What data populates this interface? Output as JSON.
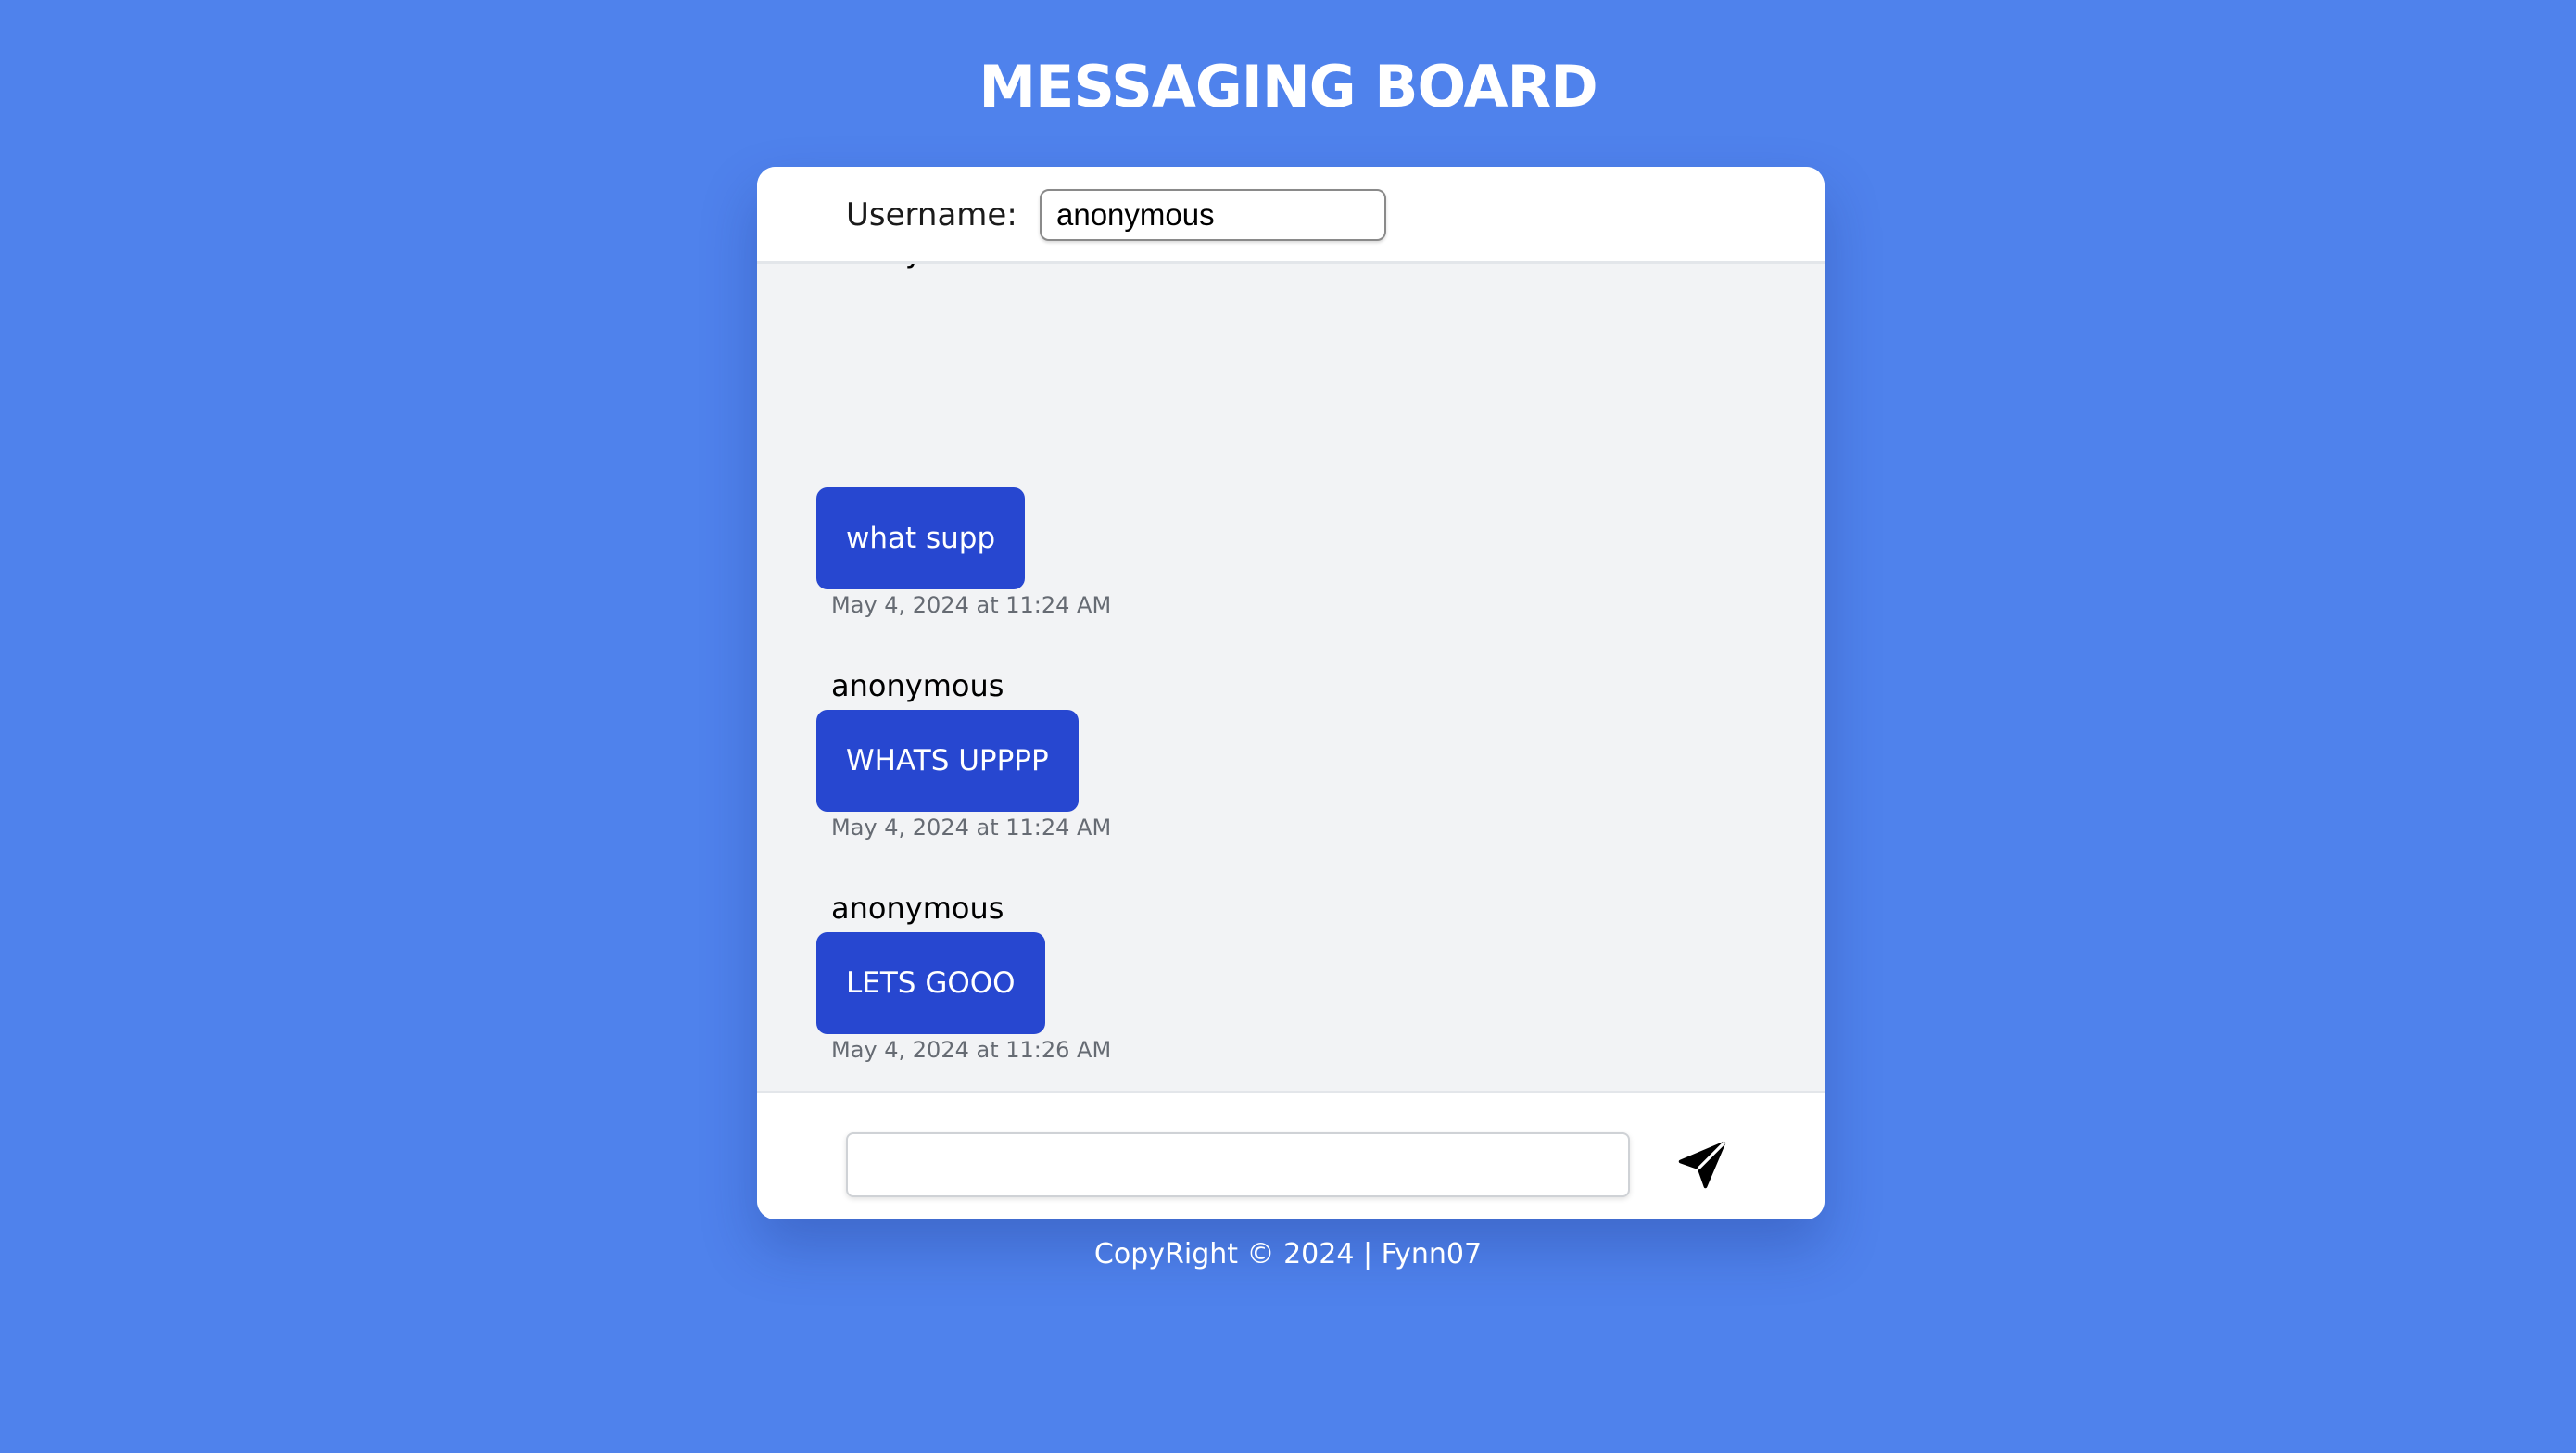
{
  "page": {
    "title": "MESSAGING BOARD",
    "copyright": "CopyRight © 2024 | Fynn07"
  },
  "header": {
    "username_label": "Username:",
    "username_value": "anonymous"
  },
  "messages": [
    {
      "user": "anonymous",
      "text": "what supp",
      "time": "May 4, 2024 at 11:24 AM"
    },
    {
      "user": "anonymous",
      "text": "WHATS UPPPP",
      "time": "May 4, 2024 at 11:24 AM"
    },
    {
      "user": "anonymous",
      "text": "LETS GOOO",
      "time": "May 4, 2024 at 11:26 AM"
    },
    {
      "user": "anonymous",
      "text": "",
      "time": ""
    }
  ],
  "composer": {
    "value": "",
    "send_icon": "send-icon"
  },
  "colors": {
    "background": "#4f82ec",
    "bubble": "#2747d0",
    "card": "#ffffff",
    "message_area": "#f2f3f5"
  }
}
